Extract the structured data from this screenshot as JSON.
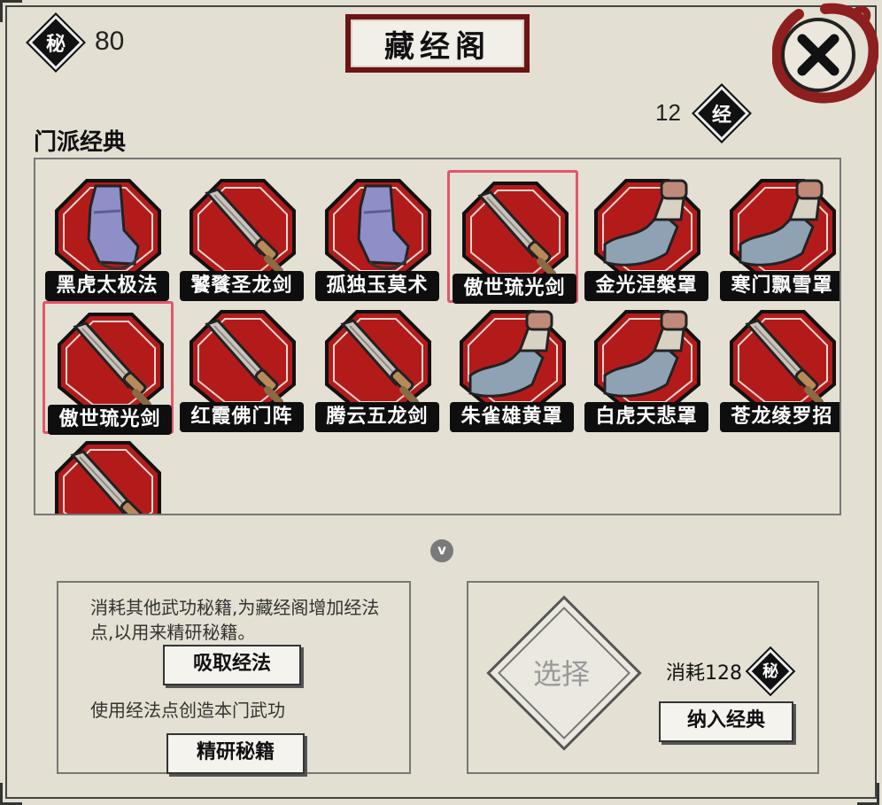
{
  "header": {
    "title": "藏经阁",
    "secret_icon_char": "秘",
    "secret_count": "80",
    "scripture_icon_char": "经",
    "scripture_count": "12"
  },
  "section_label": "门派经典",
  "cards": [
    {
      "name": "黑虎太极法",
      "icon": "boot-icon",
      "selected": false
    },
    {
      "name": "饕餮圣龙剑",
      "icon": "sword-icon",
      "selected": false
    },
    {
      "name": "孤独玉莫术",
      "icon": "boot-icon",
      "selected": false
    },
    {
      "name": "傲世琉光剑",
      "icon": "sword-icon",
      "selected": true
    },
    {
      "name": "金光涅槃罩",
      "icon": "fist-icon",
      "selected": false
    },
    {
      "name": "寒门飘雪罩",
      "icon": "fist-icon",
      "selected": false
    },
    {
      "name": "傲世琉光剑",
      "icon": "sword-icon",
      "selected": true
    },
    {
      "name": "红霞佛门阵",
      "icon": "sword-icon",
      "selected": false
    },
    {
      "name": "腾云五龙剑",
      "icon": "sword-icon",
      "selected": false
    },
    {
      "name": "朱雀雄黄罩",
      "icon": "fist-icon",
      "selected": false
    },
    {
      "name": "白虎天悲罩",
      "icon": "fist-icon",
      "selected": false
    },
    {
      "name": "苍龙绫罗招",
      "icon": "sword-icon",
      "selected": false
    },
    {
      "name": "",
      "icon": "sword-icon",
      "selected": false
    }
  ],
  "scroll_indicator": "v",
  "left_panel": {
    "desc1": "消耗其他武功秘籍,为藏经阁增加经法点,以用来精研秘籍。",
    "absorb_button": "吸取经法",
    "desc2": "使用经法点创造本门武功",
    "research_button": "精研秘籍"
  },
  "right_panel": {
    "select_label": "选择",
    "cost_text": "消耗128",
    "cost_icon_char": "秘",
    "accept_button": "纳入经典"
  },
  "colors": {
    "accent_red": "#b31b1b",
    "selection_pink": "#e2566a",
    "background": "#e3dfd2"
  }
}
